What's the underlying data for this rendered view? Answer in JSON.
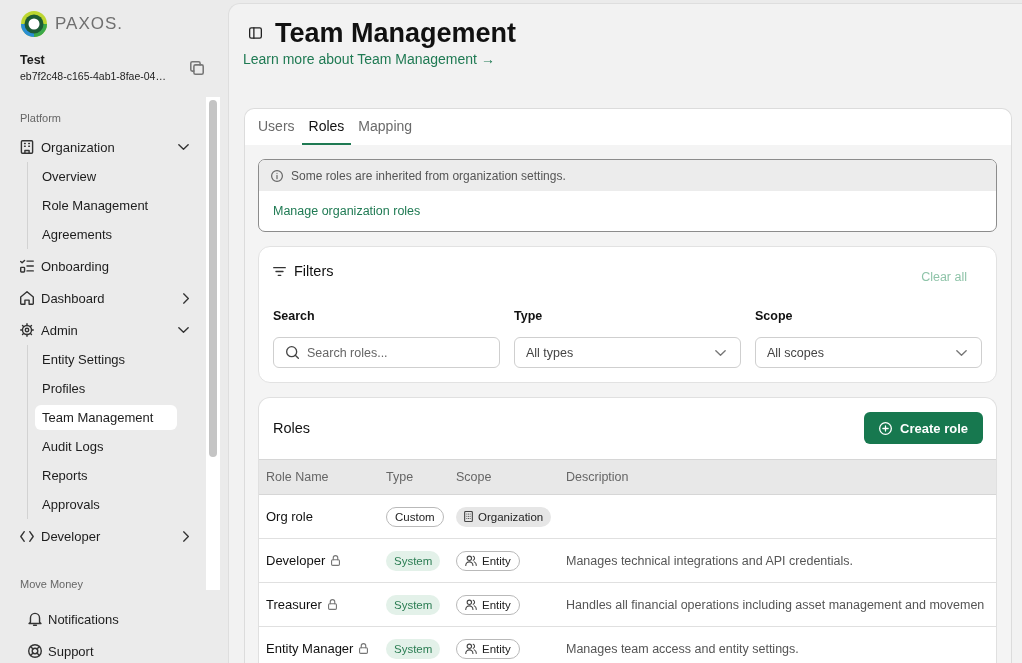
{
  "sidebar": {
    "brand": "PAXOS.",
    "account": {
      "name": "Test",
      "id": "eb7f2c48-c165-4ab1-8fae-04…"
    },
    "sections": [
      {
        "title": "Platform",
        "items": [
          {
            "label": "Organization",
            "selected": false,
            "expanded": true,
            "children": [
              {
                "label": "Overview",
                "selected": false
              },
              {
                "label": "Role Management",
                "selected": false
              },
              {
                "label": "Agreements",
                "selected": false
              }
            ]
          },
          {
            "label": "Onboarding",
            "selected": false
          },
          {
            "label": "Dashboard",
            "selected": false,
            "expanded": false
          },
          {
            "label": "Admin",
            "selected": false,
            "expanded": true,
            "children": [
              {
                "label": "Entity Settings",
                "selected": false
              },
              {
                "label": "Profiles",
                "selected": false
              },
              {
                "label": "Team Management",
                "selected": true
              },
              {
                "label": "Audit Logs",
                "selected": false
              },
              {
                "label": "Reports",
                "selected": false
              },
              {
                "label": "Approvals",
                "selected": false
              }
            ]
          },
          {
            "label": "Developer",
            "selected": false,
            "expanded": false
          }
        ]
      },
      {
        "title": "Move Money"
      }
    ],
    "footer_items": [
      {
        "label": "Notifications",
        "selected": false
      },
      {
        "label": "Support",
        "selected": false
      }
    ]
  },
  "page": {
    "title": "Team Management",
    "learn_more_link": "Learn more about Team Management →"
  },
  "tabs": [
    {
      "label": "Users",
      "selected": false
    },
    {
      "label": "Roles",
      "selected": true
    },
    {
      "label": "Mapping",
      "selected": false
    }
  ],
  "notice": {
    "message": "Some roles are inherited from organization settings.",
    "link": "Manage organization roles"
  },
  "filters": {
    "title": "Filters",
    "clear_all": {
      "label": "Clear all",
      "disabled": true
    },
    "fields": [
      {
        "kind": "search",
        "label": "Search",
        "placeholder": "Search roles..."
      },
      {
        "kind": "select",
        "label": "Type",
        "value": "All types"
      },
      {
        "kind": "select",
        "label": "Scope",
        "value": "All scopes"
      }
    ]
  },
  "roles": {
    "title": "Roles",
    "create_button": "Create role",
    "columns": [
      "Role Name",
      "Type",
      "Scope",
      "Description"
    ],
    "rows": [
      {
        "name": "Org role",
        "locked": false,
        "type": {
          "label": "Custom",
          "kind": "custom"
        },
        "scope": {
          "label": "Organization",
          "kind": "organization"
        }
      },
      {
        "name": "Developer",
        "locked": true,
        "type": {
          "label": "System",
          "kind": "system"
        },
        "scope": {
          "label": "Entity",
          "kind": "entity"
        },
        "description": "Manages technical integrations and API credentials."
      },
      {
        "name": "Treasurer",
        "locked": true,
        "type": {
          "label": "System",
          "kind": "system"
        },
        "scope": {
          "label": "Entity",
          "kind": "entity"
        },
        "description": "Handles all financial operations including asset management and movemen"
      },
      {
        "name": "Entity Manager",
        "locked": true,
        "type": {
          "label": "System",
          "kind": "system"
        },
        "scope": {
          "label": "Entity",
          "kind": "entity"
        },
        "description": "Manages team access and entity settings."
      }
    ]
  }
}
